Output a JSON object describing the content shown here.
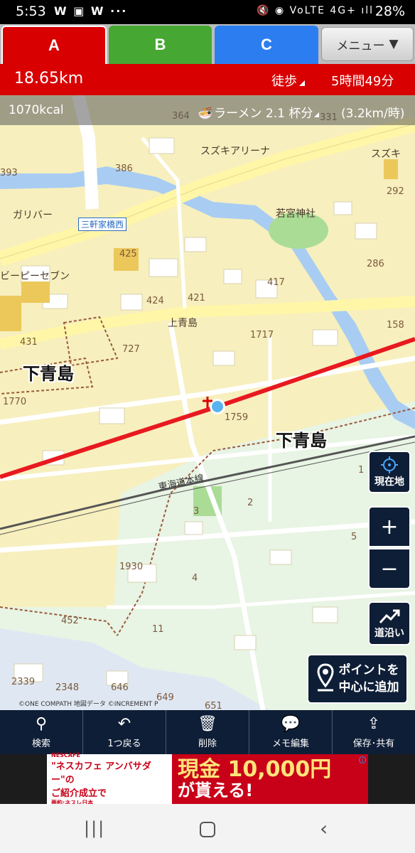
{
  "status_bar": {
    "time": "5:53",
    "notifications": "W ▣ W ···",
    "system_icons": "🔇 ◉ VoLTE 4G+ ıll",
    "battery": "28%"
  },
  "tabs": [
    {
      "label": "A",
      "color": "#d80000",
      "active": true
    },
    {
      "label": "B",
      "color": "#46a832",
      "active": false
    },
    {
      "label": "C",
      "color": "#2c7ef0",
      "active": false
    }
  ],
  "menu_button": {
    "label": "メニュー",
    "arrow": "▼"
  },
  "route_info": {
    "distance": "18.65km",
    "mode": "徒歩",
    "duration": "5時間49分"
  },
  "calorie_bar": {
    "calories": "1070kcal",
    "ramen_icon": "🍜",
    "ramen_text": "ラーメン 2.1 杯分",
    "pace": "(3.2km/時)"
  },
  "map": {
    "place_names": [
      "下青島",
      "下青島"
    ],
    "pois": [
      "スズキアリーナ",
      "スズキ",
      "ガリバー",
      "若宮神社",
      "ビーピーセブン",
      "上青島"
    ],
    "station_label": "三軒家橋西",
    "railway": "東海道本線",
    "block_numbers": [
      "364",
      "331",
      "386",
      "393",
      "292",
      "425",
      "286",
      "424",
      "421",
      "417",
      "158",
      "1717",
      "431",
      "727",
      "1770",
      "1759",
      "1",
      "2",
      "3",
      "5",
      "1930",
      "4",
      "452",
      "11",
      "2339",
      "2348",
      "646",
      "649",
      "651"
    ],
    "copyright": "©ONE COMPATH 地図データ ©INCREMENT P",
    "colors": {
      "route": "#e8191f",
      "land": "#f7efbe",
      "green_area": "#e8f4e4",
      "river": "#a9cdf2",
      "park": "#aadc96"
    }
  },
  "map_buttons": {
    "locate": "現在地",
    "zoom_in": "+",
    "zoom_out": "−",
    "along_road": "道沿い",
    "add_point_line1": "ポイントを",
    "add_point_line2": "中心に追加"
  },
  "toolbar": [
    {
      "icon": "search-icon",
      "glyph": "⚲",
      "label": "検索"
    },
    {
      "icon": "undo-icon",
      "glyph": "↶",
      "label": "1つ戻る"
    },
    {
      "icon": "trash-icon",
      "glyph": "🗑",
      "label": "削除"
    },
    {
      "icon": "memo-icon",
      "glyph": "💬",
      "label": "メモ編集"
    },
    {
      "icon": "share-icon",
      "glyph": "⇪",
      "label": "保存･共有"
    }
  ],
  "ad": {
    "brand": "NESCAFÉ",
    "headline_1": "\"ネスカフェ アンバサダー\"の",
    "headline_2": "ご紹介成立で",
    "amount": "現金 10,000円",
    "sub": "が貰える!",
    "sponsor": "要約:ネスレ日本",
    "info": "i"
  },
  "nav_bar": {
    "recent": "|||",
    "back": "‹"
  }
}
